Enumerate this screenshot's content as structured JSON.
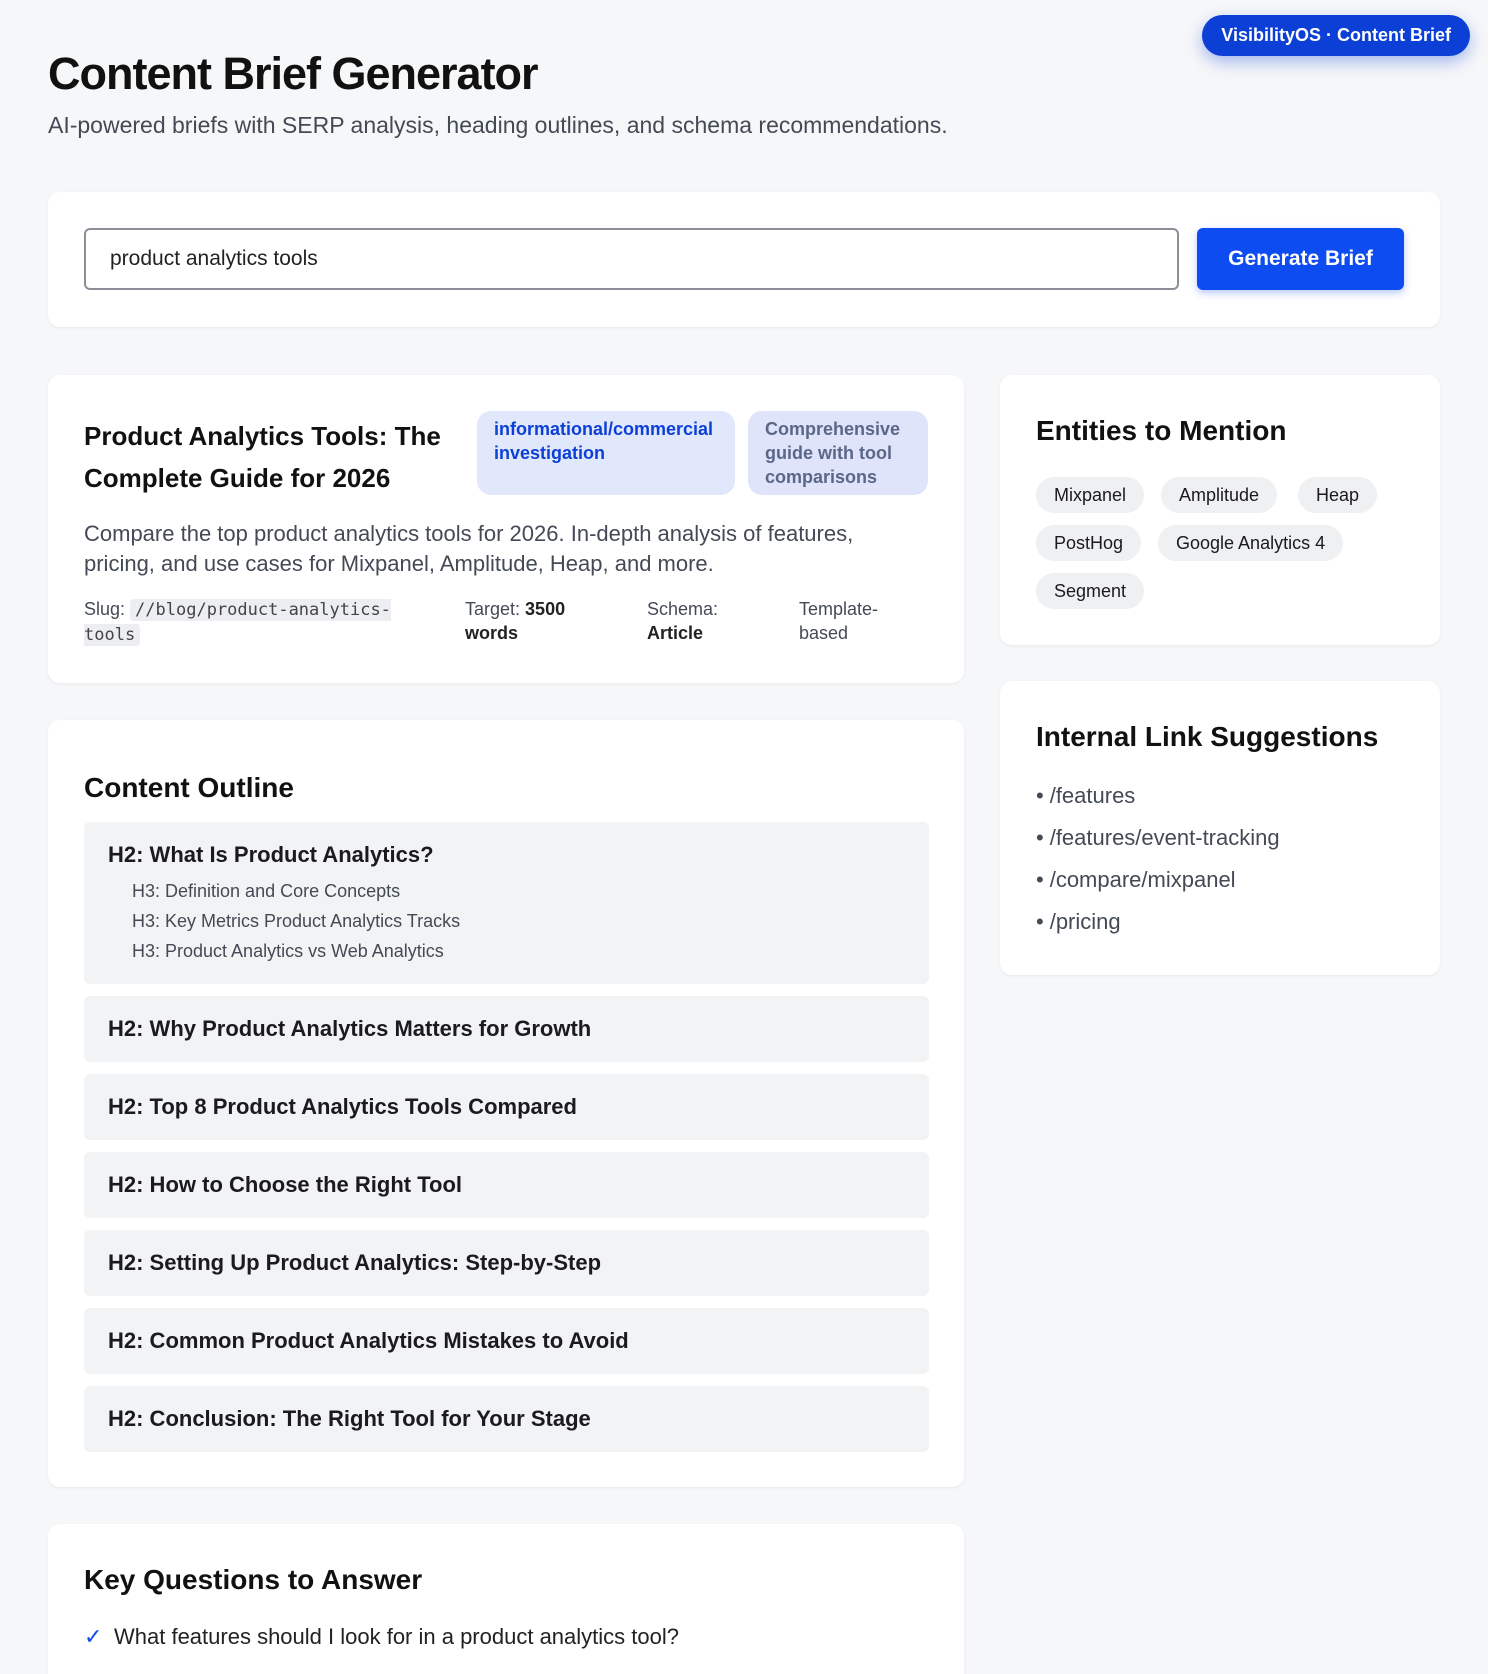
{
  "badge": "VisibilityOS · Content Brief",
  "header": {
    "title": "Content Brief Generator",
    "subtitle": "AI-powered briefs with SERP analysis, heading outlines, and schema recommendations."
  },
  "search": {
    "value": "product analytics tools",
    "button_label": "Generate Brief"
  },
  "brief": {
    "title": "Product Analytics Tools: The Complete Guide for 2026",
    "intent_tag": "informational/commercial investigation",
    "format_tag": "Comprehensive guide with tool comparisons",
    "description": "Compare the top product analytics tools for 2026. In-depth analysis of features, pricing, and use cases for Mixpanel, Amplitude, Heap, and more.",
    "slug_label": "Slug:",
    "slug": "//blog/product-analytics-tools",
    "target_label": "Target:",
    "target_value": "3500 words",
    "schema_label": "Schema:",
    "schema_value": "Article",
    "template": "Template-based"
  },
  "outline": {
    "heading": "Content Outline",
    "sections": [
      {
        "h2": "H2: What Is Product Analytics?",
        "h3": [
          "H3: Definition and Core Concepts",
          "H3: Key Metrics Product Analytics Tracks",
          "H3: Product Analytics vs Web Analytics"
        ]
      },
      {
        "h2": "H2: Why Product Analytics Matters for Growth"
      },
      {
        "h2": "H2: Top 8 Product Analytics Tools Compared"
      },
      {
        "h2": "H2: How to Choose the Right Tool"
      },
      {
        "h2": "H2: Setting Up Product Analytics: Step-by-Step"
      },
      {
        "h2": "H2: Common Product Analytics Mistakes to Avoid"
      },
      {
        "h2": "H2: Conclusion: The Right Tool for Your Stage"
      }
    ]
  },
  "questions": {
    "heading": "Key Questions to Answer",
    "check_icon": "✓",
    "items": [
      "What features should I look for in a product analytics tool?"
    ]
  },
  "entities": {
    "heading": "Entities to Mention",
    "items": [
      "Mixpanel",
      "Amplitude",
      "Heap",
      "PostHog",
      "Google Analytics 4",
      "Segment"
    ]
  },
  "links": {
    "heading": "Internal Link Suggestions",
    "bullet": "•",
    "items": [
      "/features",
      "/features/event-tracking",
      "/compare/mixpanel",
      "/pricing"
    ]
  }
}
